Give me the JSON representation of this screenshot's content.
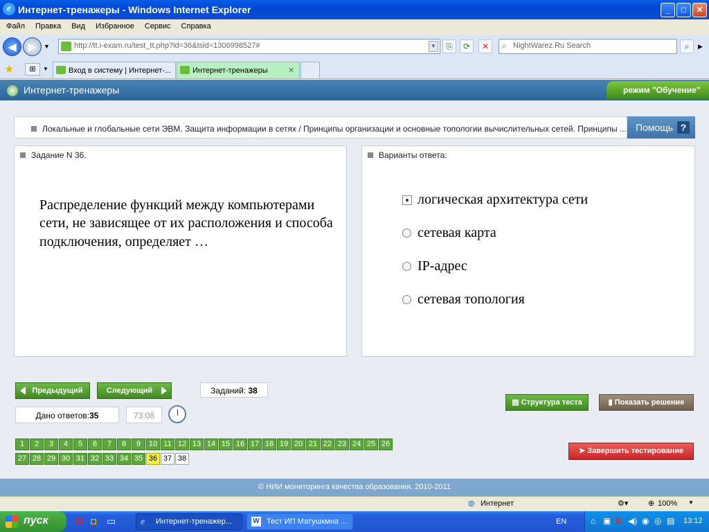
{
  "window": {
    "title": "Интернет-тренажеры - Windows Internet Explorer",
    "minimize": "_",
    "maximize": "□",
    "close": "✕"
  },
  "menu": [
    "Файл",
    "Правка",
    "Вид",
    "Избранное",
    "Сервис",
    "Справка"
  ],
  "address": {
    "url": "http://tt.i-exam.ru/test_tt.php?id=36&tsid=1306998527#"
  },
  "search": {
    "placeholder": "NightWarez.Ru Search"
  },
  "tabs": [
    {
      "label": "Вход в систему | Интернет-..."
    },
    {
      "label": "Интернет-тренажеры"
    }
  ],
  "app": {
    "title": "Интернет-тренажеры",
    "mode": "режим \"Обучение\""
  },
  "topic": {
    "text": "Локальные и глобальные сети ЭВМ. Защита информации в сетях / Принципы организации и основные топологии вычислительных сетей. Принципы ...",
    "help_label": "Помощь",
    "help_icon": "?"
  },
  "task": {
    "header": "Задание N 36.",
    "question": "Распределение функций между компьютерами сети, не зависящее от их расположения и способа подключения, определяет …"
  },
  "answers": {
    "header": "Варианты ответа:",
    "options": [
      "логическая архитектура сети",
      "сетевая карта",
      "IP-адрес",
      "сетевая топология"
    ],
    "selected_index": 0
  },
  "nav": {
    "prev": "Предыдущий",
    "next": "Следующий",
    "tasks_label": "Заданий:",
    "tasks_count": "38",
    "answered_label": "Дано ответов:",
    "answered_count": "35",
    "timer": "73:08",
    "structure": "Структура теста",
    "show_solution": "Показать решение",
    "finish": "Завершить тестирование"
  },
  "questions": {
    "numbers": [
      "1",
      "2",
      "3",
      "4",
      "5",
      "6",
      "7",
      "8",
      "9",
      "10",
      "11",
      "12",
      "13",
      "14",
      "15",
      "16",
      "17",
      "18",
      "19",
      "20",
      "21",
      "22",
      "23",
      "24",
      "25",
      "26",
      "27",
      "28",
      "29",
      "30",
      "31",
      "32",
      "33",
      "34",
      "35",
      "36",
      "37",
      "38"
    ],
    "current": "36",
    "unanswered": [
      "37",
      "38"
    ]
  },
  "footer": "© НИИ мониторинга качества образования, 2010-2011",
  "status": {
    "zone": "Интернет",
    "zoom": "100%"
  },
  "taskbar": {
    "start": "пуск",
    "items": [
      "Интернет-тренажер...",
      "Тест ИП Матушкмна ..."
    ],
    "lang": "EN",
    "time": "13:12"
  }
}
